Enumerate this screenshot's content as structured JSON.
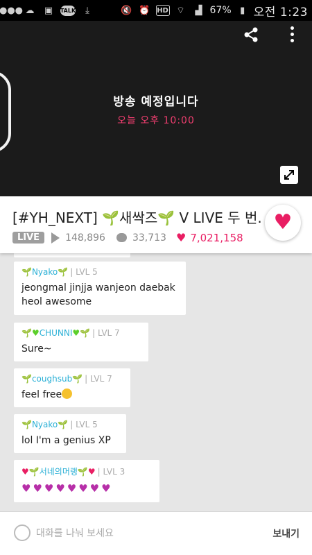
{
  "status_bar": {
    "left_icons": [
      "more-icon",
      "cloud-icon",
      "gallery-icon",
      "talk-icon",
      "download-icon"
    ],
    "talk_label": "TALK",
    "hd_label": "HD",
    "battery": "67%",
    "time": "오전 1:23"
  },
  "video": {
    "title": "방송 예정입니다",
    "subtitle": "오늘 오후 10:00"
  },
  "info": {
    "title": "[#YH_NEXT] 🌱새싹즈🌱 V LIVE 두 번...",
    "live_label": "LIVE",
    "plays": "148,896",
    "comments": "33,713",
    "likes": "7,021,158"
  },
  "chat": {
    "messages": [
      {
        "user": "Nyako",
        "level": "LVL 5",
        "text": "jeongmal jinjja wanjeon daebak heol awesome"
      },
      {
        "user": "CHUNNI",
        "level": "LVL 7",
        "text": "Sure~"
      },
      {
        "user": "coughsub",
        "level": "LVL 7",
        "text": "feel free"
      },
      {
        "user": "Nyako",
        "level": "LVL 5",
        "text": "lol I'm a genius XP"
      },
      {
        "user": "서네의머랭",
        "level": "LVL 3",
        "text": ""
      }
    ]
  },
  "input": {
    "placeholder": "대화를 나눠 보세요",
    "send_label": "보내기"
  },
  "colors": {
    "accent": "#e91e63",
    "username": "#2bb0d6",
    "video_bg": "#1b1b1b"
  }
}
